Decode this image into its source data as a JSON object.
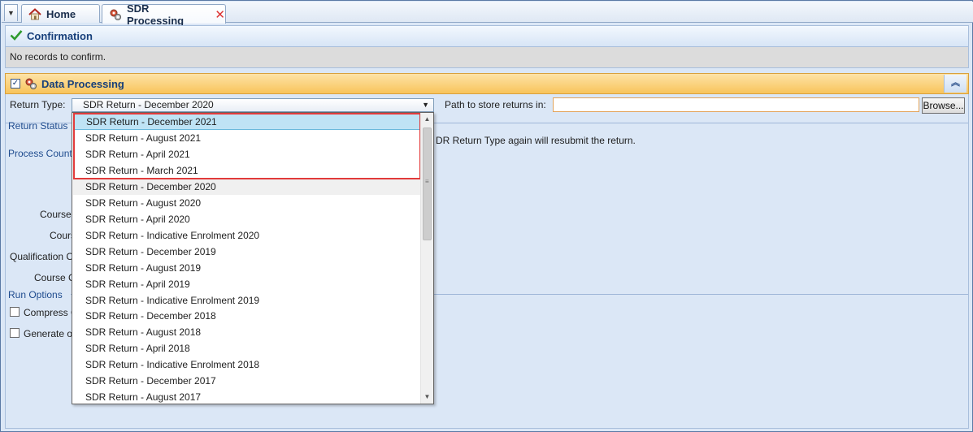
{
  "tabs": {
    "menu_glyph": "▼",
    "home_label": "Home",
    "sdr_label": "SDR Processing",
    "close_glyph": "✕"
  },
  "confirmation": {
    "title": "Confirmation",
    "message": "No records to confirm."
  },
  "data_processing": {
    "title": "Data Processing",
    "enabled": true,
    "collapse_glyph": "︽",
    "return_type_label": "Return Type:",
    "return_type_value": "SDR Return - December 2020",
    "path_label": "Path to store returns in:",
    "path_value": "",
    "browse_label": "Browse...",
    "return_status_label": "Return Status",
    "resubmit_note": "DR Return Type again will resubmit the return.",
    "process_count_label": "Process Count",
    "course_label_1": "Course",
    "course_label_2": "Cours",
    "qualification_label": "Qualification C",
    "course_label_3": "Course C",
    "run_options_label": "Run Options",
    "compress_label": "Compress C",
    "generate_label": "Generate o"
  },
  "dropdown": {
    "items": [
      "SDR Return - December 2021",
      "SDR Return - August 2021",
      "SDR Return - April 2021",
      "SDR Return - March 2021",
      "SDR Return - December 2020",
      "SDR Return - August 2020",
      "SDR Return - April 2020",
      "SDR Return - Indicative Enrolment 2020",
      "SDR Return - December 2019",
      "SDR Return - August 2019",
      "SDR Return - April 2019",
      "SDR Return - Indicative Enrolment 2019",
      "SDR Return - December 2018",
      "SDR Return - August 2018",
      "SDR Return - April 2018",
      "SDR Return - Indicative Enrolment 2018",
      "SDR Return - December 2017",
      "SDR Return - August 2017"
    ],
    "hovered_item": "SDR Return - December 2021",
    "selected_item": "SDR Return - December 2020"
  },
  "colors": {
    "highlight_border": "#e23b3b",
    "header_orange": "#f8c45b",
    "panel_blue": "#dbe7f6"
  }
}
